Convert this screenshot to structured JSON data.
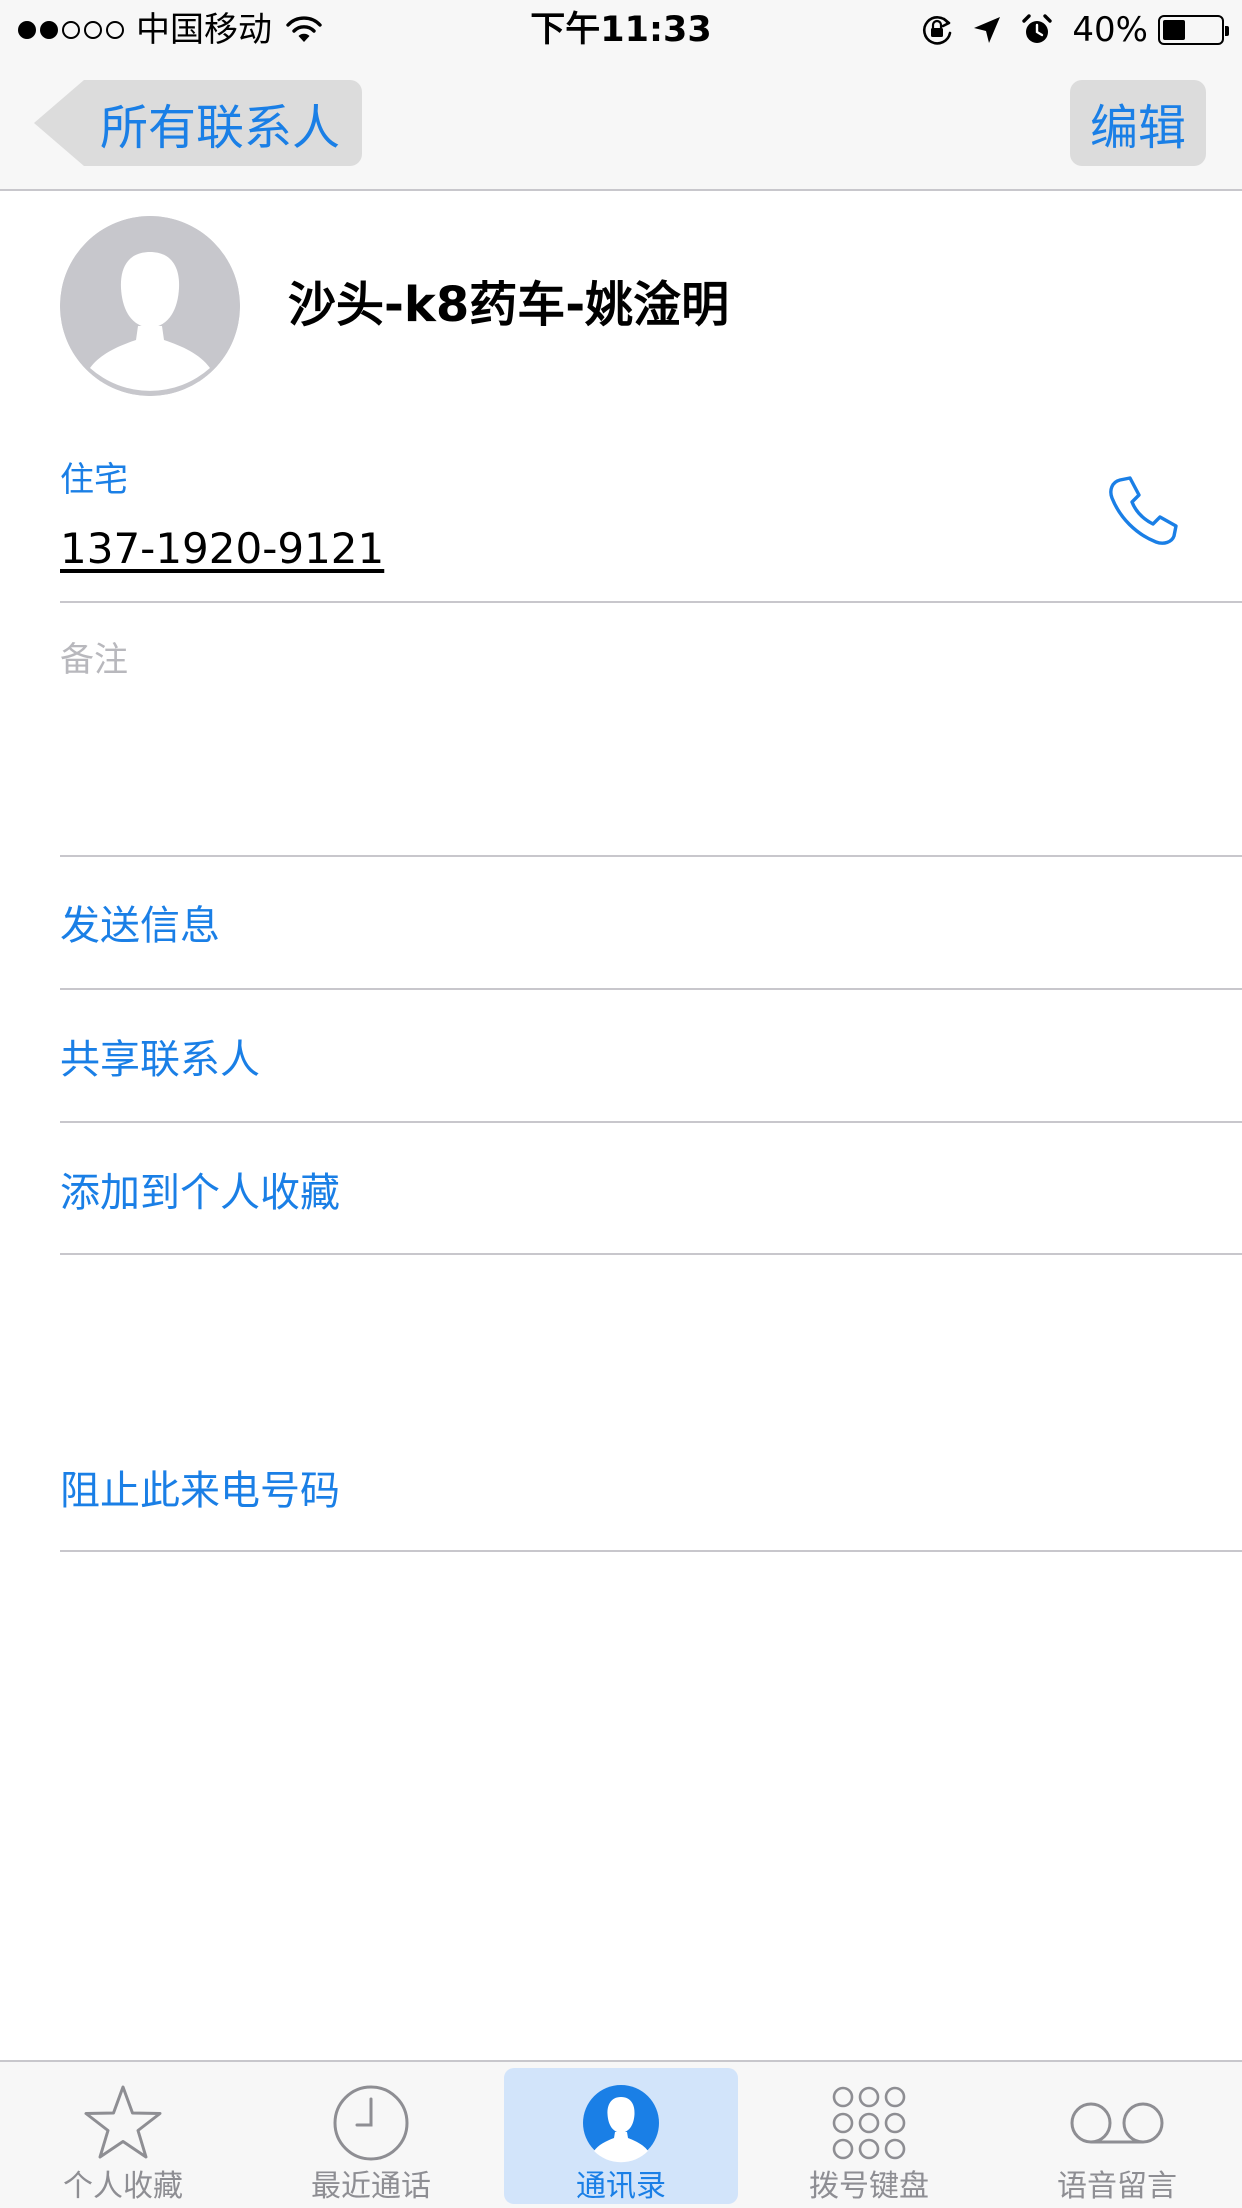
{
  "status_bar": {
    "carrier": "中国移动",
    "time": "下午11:33",
    "battery_percent": "40%",
    "battery_level": 0.4,
    "signal_strength": 2,
    "signal_max": 5,
    "icons": [
      "wifi-icon",
      "orientation-lock-icon",
      "location-arrow-icon",
      "alarm-icon",
      "battery-icon"
    ]
  },
  "nav": {
    "back_label": "所有联系人",
    "edit_label": "编辑"
  },
  "contact": {
    "name": "沙头-k8药车-姚淦明",
    "phone_label": "住宅",
    "phone_number": "137-1920-9121",
    "notes_label": "备注"
  },
  "actions": {
    "send_message": "发送信息",
    "share_contact": "共享联系人",
    "add_favorite": "添加到个人收藏",
    "block_caller": "阻止此来电号码"
  },
  "tabs": [
    {
      "label": "个人收藏",
      "icon": "star-icon",
      "selected": false
    },
    {
      "label": "最近通话",
      "icon": "clock-icon",
      "selected": false
    },
    {
      "label": "通讯录",
      "icon": "contacts-person-icon",
      "selected": true
    },
    {
      "label": "拨号键盘",
      "icon": "keypad-icon",
      "selected": false
    },
    {
      "label": "语音留言",
      "icon": "voicemail-icon",
      "selected": false
    }
  ],
  "colors": {
    "accent": "#1a7fe6",
    "bar_background": "#f7f7f7",
    "separator": "#c8c7cc",
    "selected_tab_bg": "#d2e4fa",
    "button_highlight": "#dcdcdc",
    "inactive_tab": "#8e8e93",
    "placeholder": "#b8b8bd"
  }
}
